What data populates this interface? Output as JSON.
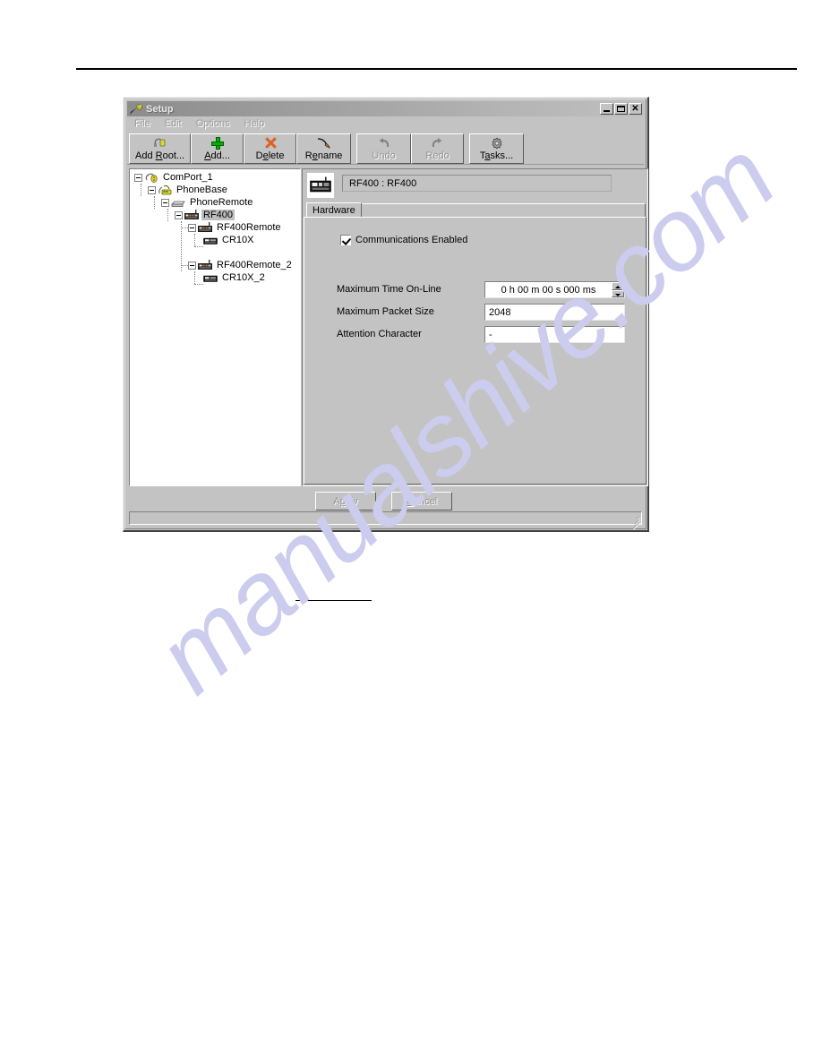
{
  "window": {
    "title": "Setup",
    "title_icon": "setup-wrench-icon",
    "controls": {
      "minimize": "minimize-button",
      "maximize": "maximize-button",
      "close_glyph": "✕"
    }
  },
  "menubar": {
    "items": [
      {
        "label": "File"
      },
      {
        "label": "Edit"
      },
      {
        "label": "Options"
      },
      {
        "label": "Help"
      }
    ]
  },
  "toolbar": {
    "buttons": [
      {
        "label": "Add Root...",
        "icon": "plug-connector-icon",
        "enabled": true
      },
      {
        "label": "Add...",
        "icon": "green-plus-icon",
        "enabled": true
      },
      {
        "label": "Delete",
        "icon": "orange-x-icon",
        "enabled": true
      },
      {
        "label": "Rename",
        "icon": "pen-icon",
        "enabled": true
      },
      {
        "label": "Undo",
        "icon": "undo-arrow-icon",
        "enabled": false
      },
      {
        "label": "Redo",
        "icon": "redo-arrow-icon",
        "enabled": false
      },
      {
        "label": "Tasks...",
        "icon": "gear-icon",
        "enabled": true
      }
    ]
  },
  "tree": {
    "nodes": [
      {
        "label": "ComPort_1",
        "depth": 0,
        "icon": "comport-icon",
        "expanded": true,
        "selected": false
      },
      {
        "label": "PhoneBase",
        "depth": 1,
        "icon": "phonebase-icon",
        "expanded": true,
        "selected": false
      },
      {
        "label": "PhoneRemote",
        "depth": 2,
        "icon": "phoneremote-icon",
        "expanded": true,
        "selected": false
      },
      {
        "label": "RF400",
        "depth": 3,
        "icon": "rf400-icon",
        "expanded": true,
        "selected": true
      },
      {
        "label": "RF400Remote",
        "depth": 4,
        "icon": "rf400remote-icon",
        "expanded": true,
        "selected": false
      },
      {
        "label": "CR10X",
        "depth": 5,
        "icon": "cr10x-icon",
        "expanded": false,
        "selected": false
      },
      {
        "label": "RF400Remote_2",
        "depth": 4,
        "icon": "rf400remote-icon",
        "expanded": true,
        "selected": false
      },
      {
        "label": "CR10X_2",
        "depth": 5,
        "icon": "cr10x-icon",
        "expanded": false,
        "selected": false
      }
    ]
  },
  "detail": {
    "header_icon": "rf400-device-icon",
    "header_text": "RF400 : RF400",
    "tabs": [
      {
        "label": "Hardware",
        "active": true
      }
    ],
    "checkbox": {
      "label": "Communications Enabled",
      "checked": true
    },
    "fields": [
      {
        "label": "Maximum Time On-Line",
        "value": "0 h 00 m 00 s 000 ms",
        "type": "spinner"
      },
      {
        "label": "Maximum Packet Size",
        "value": "2048",
        "type": "text"
      },
      {
        "label": "Attention Character",
        "value": "-",
        "type": "text"
      }
    ]
  },
  "footer": {
    "apply_label": "Apply",
    "apply_enabled": false,
    "cancel_label": "Cancel",
    "cancel_enabled": false,
    "status_text": ""
  },
  "page": {
    "watermark": "manualshive.com"
  }
}
